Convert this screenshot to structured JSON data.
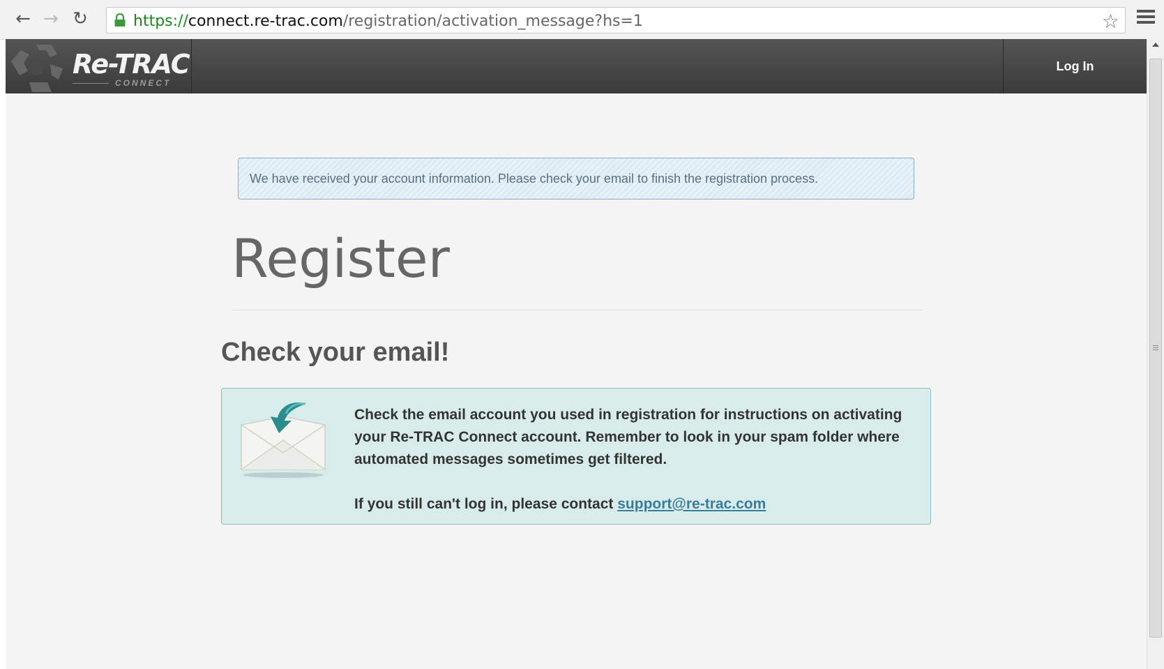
{
  "browser": {
    "url_scheme": "https://",
    "url_host": "connect.re-trac.com",
    "url_path": "/registration/activation_message?hs=1",
    "back_glyph": "←",
    "forward_glyph": "→",
    "reload_glyph": "↻",
    "star_glyph": "☆"
  },
  "navbar": {
    "brand_name": "Re-TRAC",
    "brand_sub": "CONNECT",
    "login_label": "Log In"
  },
  "alert": {
    "message": "We have received your account information. Please check your email to finish the registration process."
  },
  "main": {
    "title": "Register",
    "subheading": "Check your email!",
    "instructions": "Check the email account you used in registration for instructions on activating your Re-TRAC Connect account. Remember to look in your spam folder where automated messages sometimes get filtered.",
    "contact_prefix": "If you still can't log in, please contact ",
    "support_email": "support@re-trac.com"
  },
  "colors": {
    "navbar_bg": "#444444",
    "alert_border": "#86aed0",
    "panel_bg": "#d9ecec",
    "link": "#3a7d9a",
    "envelope_arrow": "#2a8c8c"
  }
}
